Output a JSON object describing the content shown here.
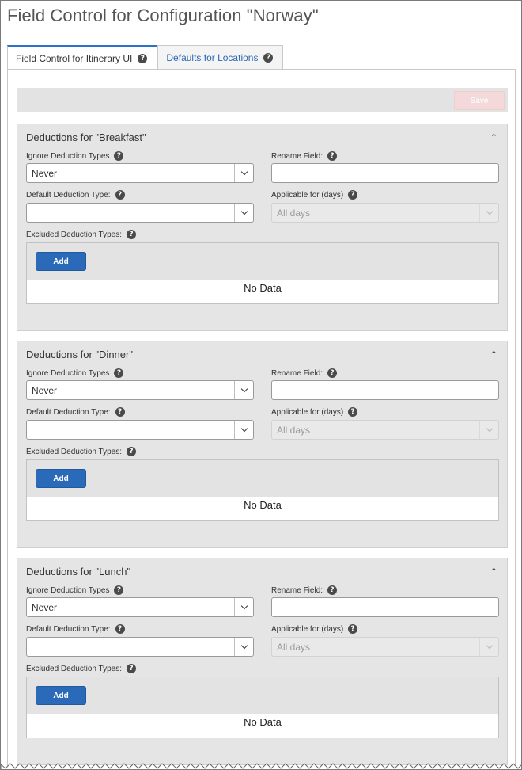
{
  "page": {
    "title": "Field Control for Configuration \"Norway\""
  },
  "tabs": [
    {
      "label": "Field Control for Itinerary UI",
      "active": true
    },
    {
      "label": "Defaults for Locations",
      "active": false
    }
  ],
  "toolbar": {
    "save_label": "Save"
  },
  "labels": {
    "ignore": "Ignore Deduction Types",
    "rename": "Rename Field:",
    "default_type": "Default Deduction Type:",
    "applicable": "Applicable for (days)",
    "excluded": "Excluded Deduction Types:",
    "add": "Add",
    "no_data": "No Data"
  },
  "sections": [
    {
      "title": "Deductions for \"Breakfast\"",
      "ignore_value": "Never",
      "rename_value": "",
      "default_value": "",
      "applicable_value": "All days"
    },
    {
      "title": "Deductions for \"Dinner\"",
      "ignore_value": "Never",
      "rename_value": "",
      "default_value": "",
      "applicable_value": "All days"
    },
    {
      "title": "Deductions for \"Lunch\"",
      "ignore_value": "Never",
      "rename_value": "",
      "default_value": "",
      "applicable_value": "All days"
    }
  ],
  "icons": {
    "help": "?"
  },
  "colors": {
    "accent": "#2a6ab8",
    "tab_border": "#2a73c9",
    "panel": "#e5e5e5"
  }
}
